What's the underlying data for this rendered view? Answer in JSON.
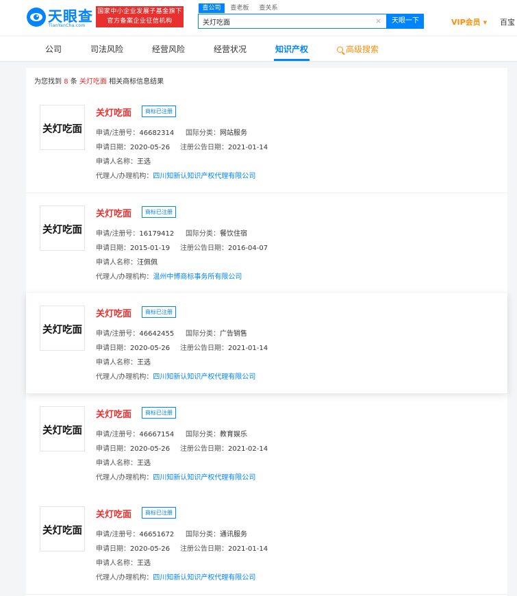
{
  "header": {
    "logo_title": "天眼查",
    "logo_sub": "TianYanCha.com",
    "banner_line1": "国家中小企业发展子基金旗下",
    "banner_line2": "官方备案企业征信机构",
    "search_tabs": [
      "查公司",
      "查老板",
      "查关系"
    ],
    "search_value": "关灯吃面",
    "clear_symbol": "×",
    "search_button": "天眼一下",
    "vip_label": "VIP会员",
    "vip_caret": "▼",
    "right_text": "百宝"
  },
  "nav": {
    "items": [
      "公司",
      "司法风险",
      "经营风险",
      "经营状况",
      "知识产权"
    ],
    "active_index": 4,
    "advanced_search": "高级搜索"
  },
  "results": {
    "prefix": "为您找到",
    "count": "8",
    "unit": "条",
    "keyword": "关灯吃面",
    "suffix": "相关商标信息结果"
  },
  "labels": {
    "reg_no": "申请/注册号：",
    "intl_class": "国际分类：",
    "apply_date": "申请日期：",
    "pub_date": "注册公告日期：",
    "applicant": "申请人名称：",
    "agent": "代理人/办理机构："
  },
  "trademarks": [
    {
      "name": "关灯吃面",
      "status": "商标已注册",
      "reg_no": "46682314",
      "intl_class": "网站服务",
      "apply_date": "2020-05-26",
      "pub_date": "2021-01-14",
      "applicant": "王选",
      "agent": "四川知新认知识产权代理有限公司",
      "logo_text": "关灯吃面"
    },
    {
      "name": "关灯吃面",
      "status": "商标已注册",
      "reg_no": "16179412",
      "intl_class": "餐饮住宿",
      "apply_date": "2015-01-19",
      "pub_date": "2016-04-07",
      "applicant": "汪佩佩",
      "agent": "温州中博商标事务所有限公司",
      "logo_text": "关灯吃面"
    },
    {
      "name": "关灯吃面",
      "status": "商标已注册",
      "reg_no": "46642455",
      "intl_class": "广告销售",
      "apply_date": "2020-05-26",
      "pub_date": "2021-01-14",
      "applicant": "王选",
      "agent": "四川知新认知识产权代理有限公司",
      "logo_text": "关灯吃面"
    },
    {
      "name": "关灯吃面",
      "status": "商标已注册",
      "reg_no": "46667154",
      "intl_class": "教育娱乐",
      "apply_date": "2020-05-26",
      "pub_date": "2021-02-14",
      "applicant": "王选",
      "agent": "四川知新认知识产权代理有限公司",
      "logo_text": "关灯吃面"
    },
    {
      "name": "关灯吃面",
      "status": "商标已注册",
      "reg_no": "46651672",
      "intl_class": "通讯服务",
      "apply_date": "2020-05-26",
      "pub_date": "2021-01-14",
      "applicant": "王选",
      "agent": "四川知新认知识产权代理有限公司",
      "logo_text": "关灯吃面"
    }
  ],
  "colors": {
    "brand_blue": "#0084ff",
    "accent_red": "#e8312f",
    "vip_orange": "#ff8e0a"
  }
}
